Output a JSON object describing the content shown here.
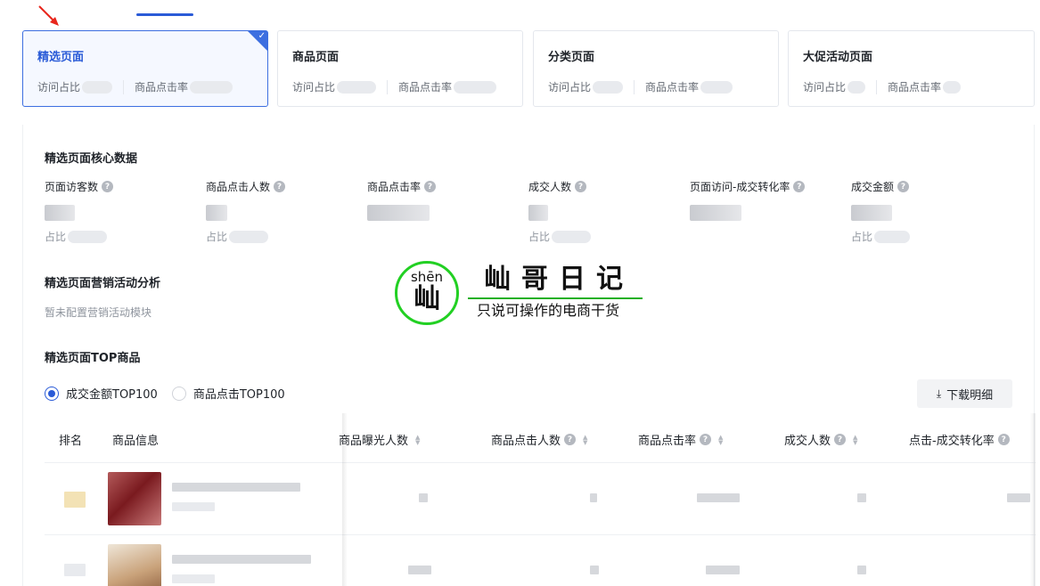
{
  "cards": [
    {
      "title": "精选页面",
      "visit_label": "访问占比",
      "click_label": "商品点击率",
      "active": true
    },
    {
      "title": "商品页面",
      "visit_label": "访问占比",
      "click_label": "商品点击率",
      "active": false
    },
    {
      "title": "分类页面",
      "visit_label": "访问占比",
      "click_label": "商品点击率",
      "active": false
    },
    {
      "title": "大促活动页面",
      "visit_label": "访问占比",
      "click_label": "商品点击率",
      "active": false
    }
  ],
  "core": {
    "title": "精选页面核心数据",
    "metrics": [
      {
        "label": "页面访客数",
        "sub": "占比"
      },
      {
        "label": "商品点击人数",
        "sub": "占比"
      },
      {
        "label": "商品点击率",
        "sub": ""
      },
      {
        "label": "成交人数",
        "sub": "占比"
      },
      {
        "label": "页面访问-成交转化率",
        "sub": ""
      },
      {
        "label": "成交金额",
        "sub": "占比"
      }
    ]
  },
  "marketing": {
    "title": "精选页面营销活动分析",
    "empty": "暂未配置营销活动模块"
  },
  "watermark": {
    "pinyin": "shēn",
    "char": "屾",
    "title": "屾哥日记",
    "subtitle": "只说可操作的电商干货"
  },
  "top": {
    "title": "精选页面TOP商品",
    "radio_amount": "成交金额TOP100",
    "radio_click": "商品点击TOP100",
    "download": "下载明细",
    "columns": {
      "rank": "排名",
      "info": "商品信息",
      "exposure": "商品曝光人数",
      "clickers": "商品点击人数",
      "click_rate": "商品点击率",
      "buyers": "成交人数",
      "conversion": "点击-成交转化率"
    }
  },
  "colors": {
    "accent": "#2a5bd7",
    "watermark_green": "#22d023",
    "arrow": "#e8261c"
  }
}
